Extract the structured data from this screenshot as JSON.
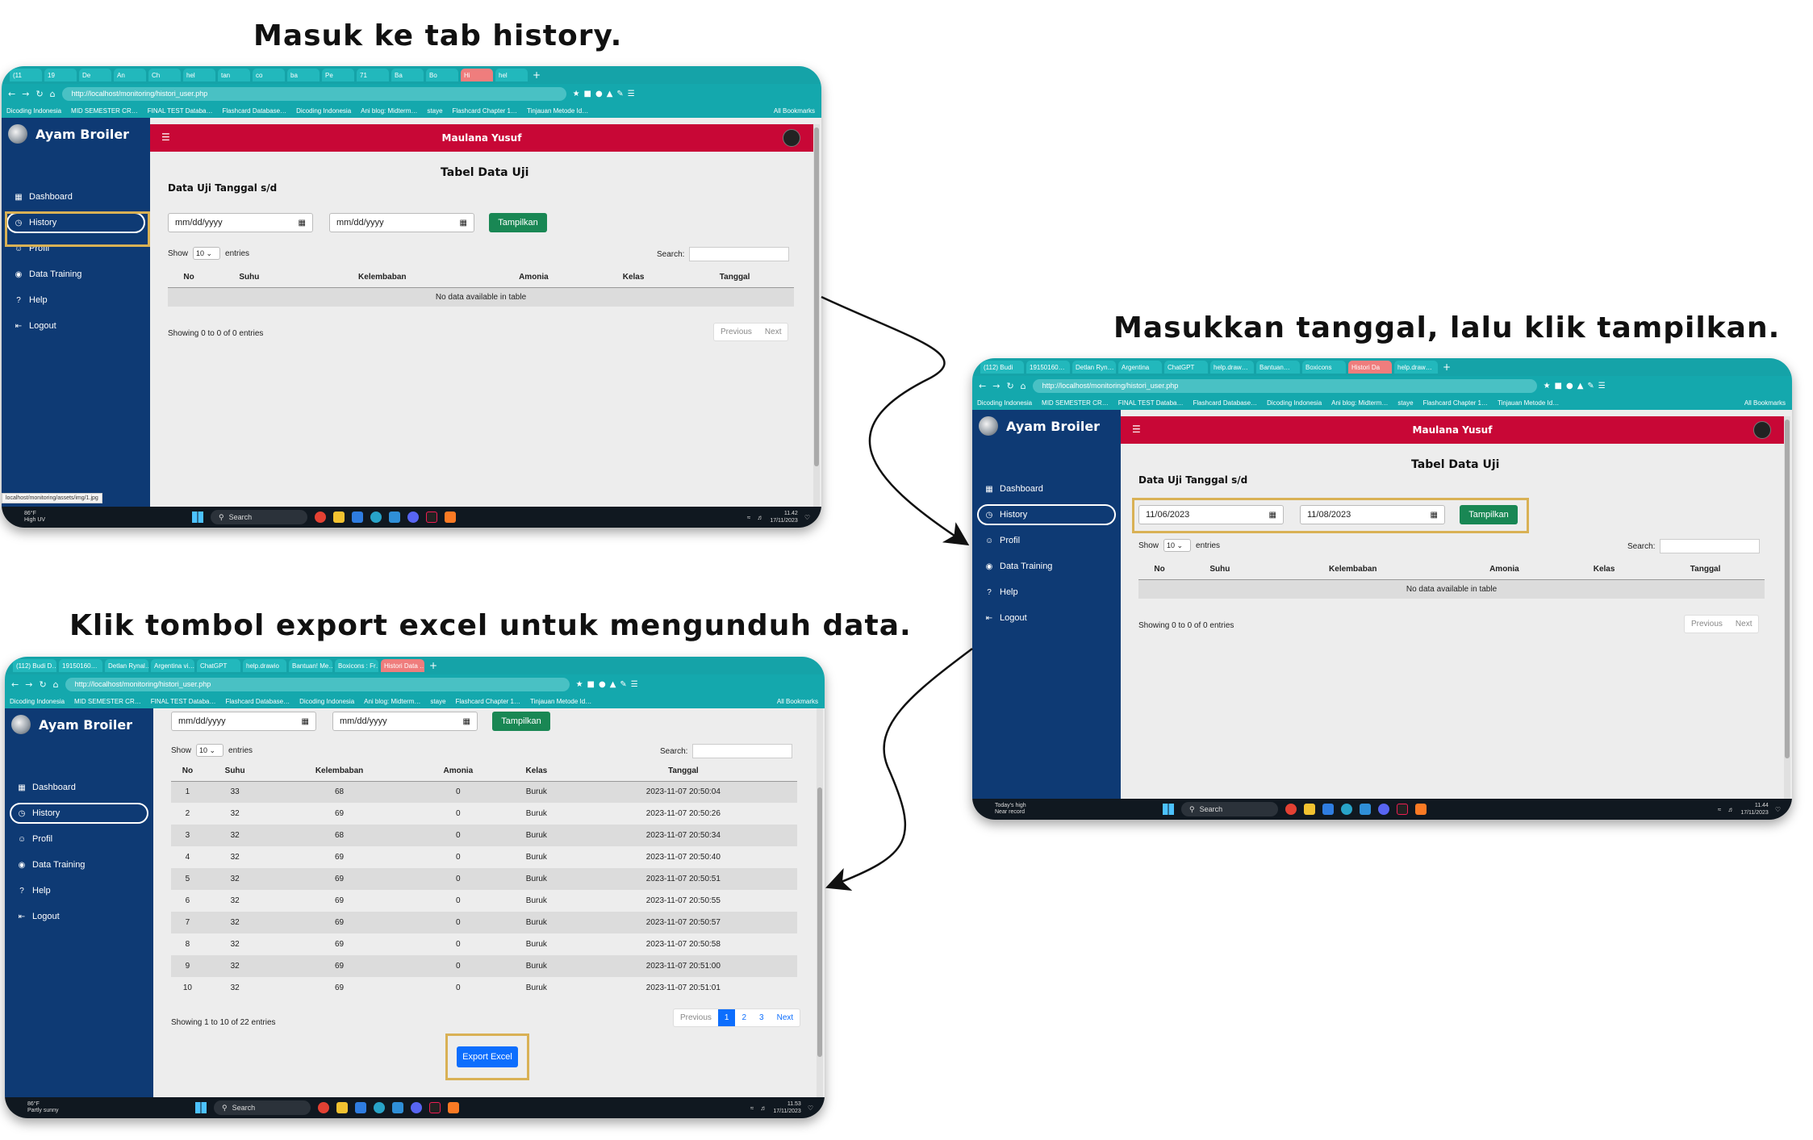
{
  "captions": {
    "step1": "Masuk ke tab history.",
    "step2": "Masukkan tanggal, lalu klik tampilkan.",
    "step3": "Klik tombol export excel untuk mengunduh data."
  },
  "browser": {
    "url": "http://localhost/monitoring/histori_user.php",
    "tabs1": [
      "(11",
      "19",
      "De",
      "An",
      "Ch",
      "hel",
      "tan",
      "co",
      "ba",
      "Pe",
      "71",
      "Ba",
      "Bo",
      "Hi",
      "hel"
    ],
    "tabs2": [
      "(112) Budi",
      "19150160…",
      "Detlan Ryn…",
      "Argentina",
      "ChatGPT",
      "help.draw…",
      "Bantuan…",
      "Boxicons",
      "Histori Da",
      "help.draw…"
    ],
    "tabs3": [
      "(112) Budi D…",
      "19150160…",
      "Detlan Rynal…",
      "Argentina vi…",
      "ChatGPT",
      "help.drawio",
      "Bantuan! Me…",
      "Boxicons : Fr…",
      "Histori Data …"
    ],
    "bookmarks": [
      "Dicoding Indonesia",
      "MID SEMESTER CR…",
      "FINAL TEST Databa…",
      "Flashcard Database…",
      "Dicoding Indonesia",
      "Ani blog: Midterm…",
      "staye",
      "Flashcard Chapter 1…",
      "Tinjauan Metode Id…"
    ],
    "all_bookmarks": "All Bookmarks",
    "status_url": "localhost/monitoring/assets/img/1.jpg"
  },
  "app": {
    "brand": "Ayam Broiler",
    "user": "Maulana Yusuf",
    "menu": [
      {
        "icon": "▦",
        "label": "Dashboard"
      },
      {
        "icon": "◷",
        "label": "History"
      },
      {
        "icon": "☺",
        "label": "Profil"
      },
      {
        "icon": "◉",
        "label": "Data Training"
      },
      {
        "icon": "?",
        "label": "Help"
      },
      {
        "icon": "⇤",
        "label": "Logout"
      }
    ]
  },
  "page": {
    "title": "Tabel Data Uji",
    "subtitle": "Data Uji Tanggal s/d",
    "date_placeholder": "mm/dd/yyyy",
    "date_from": "11/06/2023",
    "date_to": "11/08/2023",
    "show_btn": "Tampilkan",
    "show_label": "Show",
    "show_value": "10",
    "entries_label": "entries",
    "search_label": "Search:",
    "columns": [
      "No",
      "Suhu",
      "Kelembaban",
      "Amonia",
      "Kelas",
      "Tanggal"
    ],
    "empty": "No data available in table",
    "info_empty": "Showing 0 to 0 of 0 entries",
    "info_filled": "Showing 1 to 10 of 22 entries",
    "prev": "Previous",
    "next": "Next",
    "pages": [
      "1",
      "2",
      "3"
    ],
    "export_btn": "Export Excel",
    "rows": [
      [
        "1",
        "33",
        "68",
        "0",
        "Buruk",
        "2023-11-07 20:50:04"
      ],
      [
        "2",
        "32",
        "69",
        "0",
        "Buruk",
        "2023-11-07 20:50:26"
      ],
      [
        "3",
        "32",
        "68",
        "0",
        "Buruk",
        "2023-11-07 20:50:34"
      ],
      [
        "4",
        "32",
        "69",
        "0",
        "Buruk",
        "2023-11-07 20:50:40"
      ],
      [
        "5",
        "32",
        "69",
        "0",
        "Buruk",
        "2023-11-07 20:50:51"
      ],
      [
        "6",
        "32",
        "69",
        "0",
        "Buruk",
        "2023-11-07 20:50:55"
      ],
      [
        "7",
        "32",
        "69",
        "0",
        "Buruk",
        "2023-11-07 20:50:57"
      ],
      [
        "8",
        "32",
        "69",
        "0",
        "Buruk",
        "2023-11-07 20:50:58"
      ],
      [
        "9",
        "32",
        "69",
        "0",
        "Buruk",
        "2023-11-07 20:51:00"
      ],
      [
        "10",
        "32",
        "69",
        "0",
        "Buruk",
        "2023-11-07 20:51:01"
      ]
    ]
  },
  "taskbar": {
    "search": "Search",
    "weather1_temp": "86°F",
    "weather1_desc": "High UV",
    "weather2_temp": "Today's high",
    "weather2_desc": "Near record",
    "weather3_temp": "86°F",
    "weather3_desc": "Partly sunny",
    "time1": "11.42",
    "time2": "11.44",
    "time3": "11.53",
    "date": "17/11/2023"
  },
  "colors": {
    "sidebar": "#0e3a74",
    "topbar": "#c80736",
    "browser": "#15a3a8",
    "highlight": "#d9b155",
    "green": "#198754",
    "blue": "#0d6efd"
  }
}
